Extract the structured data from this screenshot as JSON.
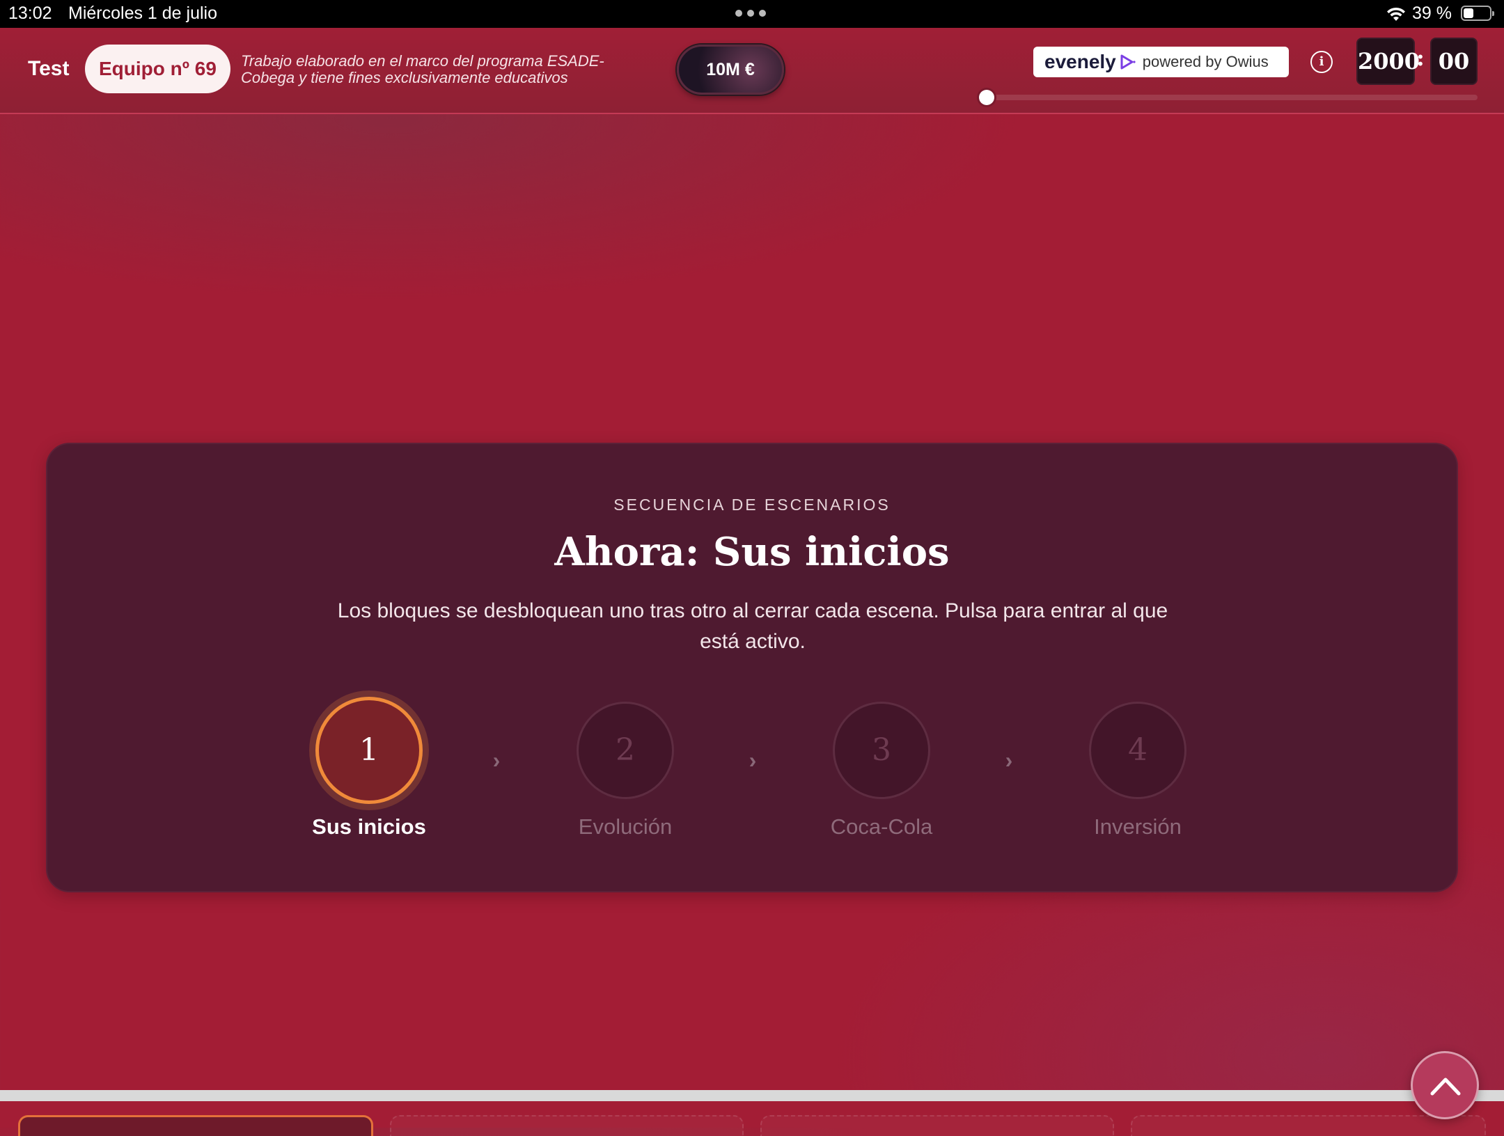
{
  "status_bar": {
    "time": "13:02",
    "date": "Miércoles 1 de julio",
    "battery": "39 %",
    "icons": [
      "wifi-icon",
      "battery-icon",
      "multitasking-dots-icon"
    ]
  },
  "header": {
    "brand": "Test",
    "team": "Equipo nº 69",
    "disclaimer": "Trabajo elaborado en el marco del programa ESADE-Cobega y tiene fines exclusivamente educativos",
    "money": "10M €",
    "partner_logo": "evenely",
    "partner_powered": "powered by Owius",
    "clock": {
      "year": "2000",
      "separator": ":",
      "minutes": "00"
    },
    "timeline_progress": 0
  },
  "panel": {
    "eyebrow": "SECUENCIA DE ESCENARIOS",
    "title": "Ahora: Sus inicios",
    "subtitle": "Los bloques se desbloquean uno tras otro al cerrar cada escena. Pulsa para entrar al que está activo.",
    "separator": "›",
    "steps": [
      {
        "number": "1",
        "label": "Sus inicios",
        "state": "active"
      },
      {
        "number": "2",
        "label": "Evolución",
        "state": "locked"
      },
      {
        "number": "3",
        "label": "Coca-Cola",
        "state": "locked"
      },
      {
        "number": "4",
        "label": "Inversión",
        "state": "locked"
      }
    ]
  },
  "colors": {
    "background": "#a31d35",
    "panel": "#4f1a30",
    "accent": "#f08a3a",
    "team_text": "#a01f36"
  }
}
